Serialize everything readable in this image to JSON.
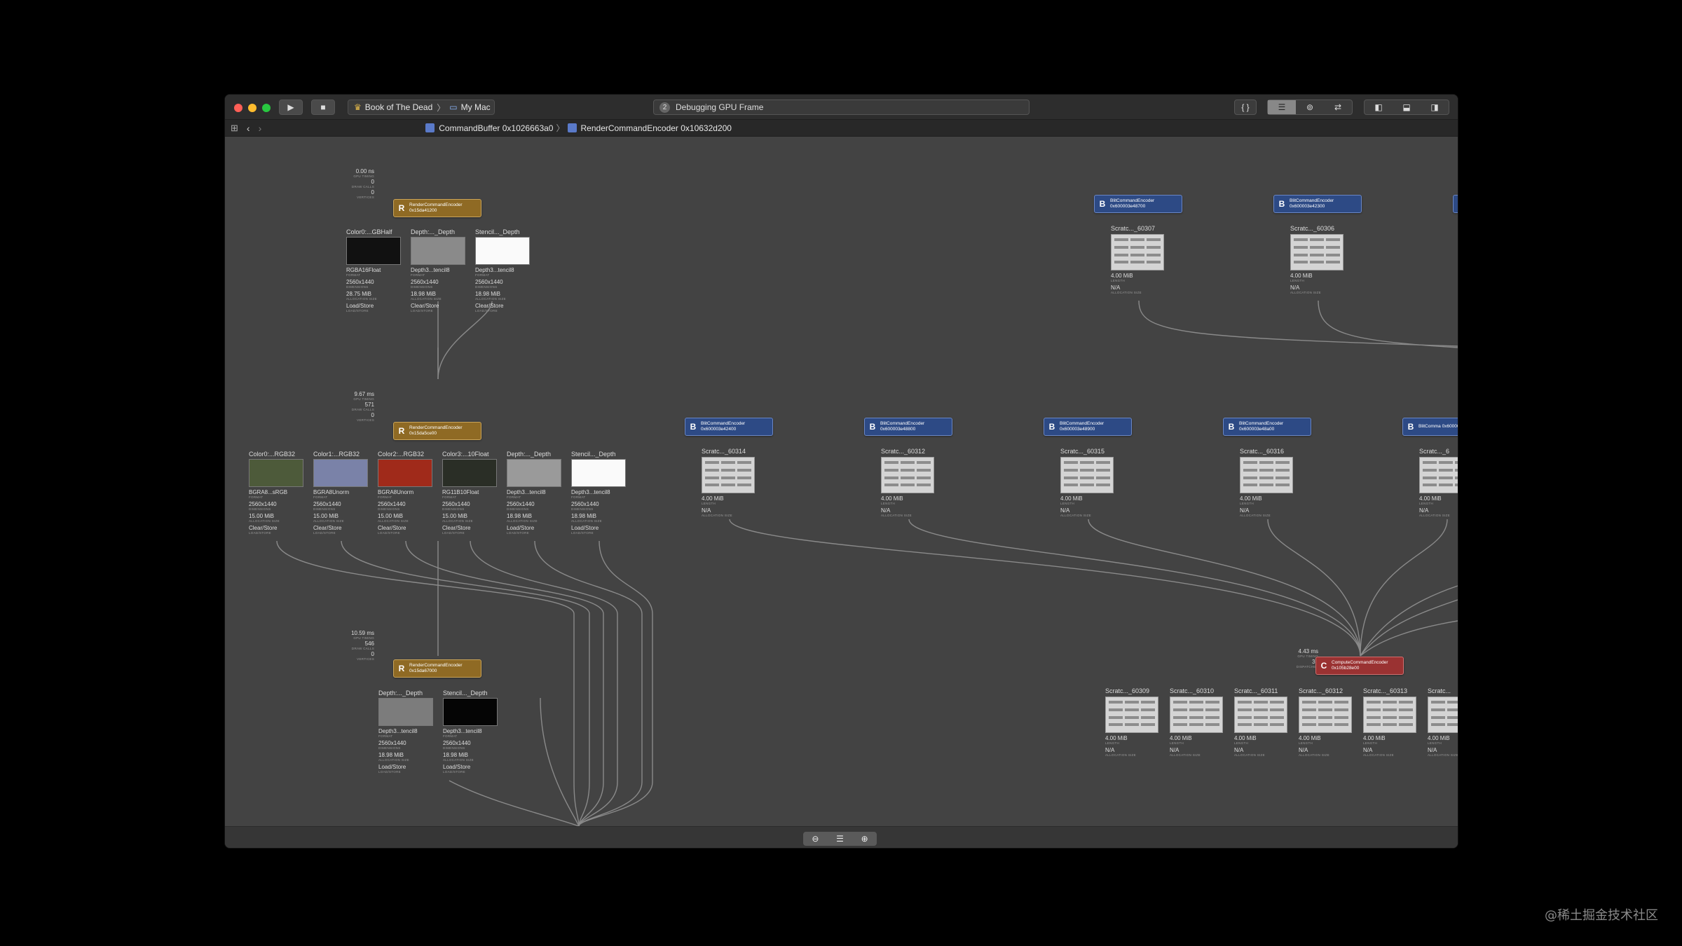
{
  "window": {
    "scheme": "Book of The Dead",
    "destination": "My Mac",
    "activity_number": "2",
    "activity_text": "Debugging GPU Frame"
  },
  "breadcrumb": {
    "item1": "CommandBuffer 0x1026663a0",
    "item2": "RenderCommandEncoder 0x10632d200"
  },
  "labels": {
    "gpu_timing": "GPU TIMING",
    "draw_calls": "DRAW CALLS",
    "vertices": "VERTICES",
    "format": "FORMAT",
    "dimensions": "DIMENSIONS",
    "allocation_size": "ALLOCATION SIZE",
    "load_store": "LOAD/STORE",
    "length": "LENGTH",
    "dispatches": "DISPATCHES"
  },
  "render_encoders": [
    {
      "letter": "R",
      "name": "RenderCommandEncoder 0x15da41200",
      "timing": "0.00 ns",
      "draws": "0",
      "vertices": "0"
    },
    {
      "letter": "R",
      "name": "RenderCommandEncoder 0x15da5ce00",
      "timing": "9.67 ms",
      "draws": "571",
      "vertices": "0"
    },
    {
      "letter": "R",
      "name": "RenderCommandEncoder 0x15da67000",
      "timing": "10.59 ms",
      "draws": "546",
      "vertices": "0"
    }
  ],
  "attachments_1": [
    {
      "title": "Color0:...GBHalf",
      "format": "RGBA16Float",
      "dims": "2560x1440",
      "size": "28.75 MiB",
      "ls": "Load/Store",
      "thumb": "#111"
    },
    {
      "title": "Depth:..._Depth",
      "format": "Depth3...tencil8",
      "dims": "2560x1440",
      "size": "18.98 MiB",
      "ls": "Clear/Store",
      "thumb": "#8a8a8a"
    },
    {
      "title": "Stencil..._Depth",
      "format": "Depth3...tencil8",
      "dims": "2560x1440",
      "size": "18.98 MiB",
      "ls": "Clear/Store",
      "thumb": "#fafafa"
    }
  ],
  "attachments_2": [
    {
      "title": "Color0:...RGB32",
      "format": "BGRA8...sRGB",
      "dims": "2560x1440",
      "size": "15.00 MiB",
      "ls": "Clear/Store",
      "thumb": "#4d5a3a"
    },
    {
      "title": "Color1:...RGB32",
      "format": "BGRA8Unorm",
      "dims": "2560x1440",
      "size": "15.00 MiB",
      "ls": "Clear/Store",
      "thumb": "#7a82a8"
    },
    {
      "title": "Color2:...RGB32",
      "format": "BGRA8Unorm",
      "dims": "2560x1440",
      "size": "15.00 MiB",
      "ls": "Clear/Store",
      "thumb": "#a02a1a"
    },
    {
      "title": "Color3:...10Float",
      "format": "RG11B10Float",
      "dims": "2560x1440",
      "size": "15.00 MiB",
      "ls": "Clear/Store",
      "thumb": "#2a2e26"
    },
    {
      "title": "Depth:..._Depth",
      "format": "Depth3...tencil8",
      "dims": "2560x1440",
      "size": "18.98 MiB",
      "ls": "Load/Store",
      "thumb": "#9a9a9a"
    },
    {
      "title": "Stencil..._Depth",
      "format": "Depth3...tencil8",
      "dims": "2560x1440",
      "size": "18.98 MiB",
      "ls": "Load/Store",
      "thumb": "#fafafa"
    }
  ],
  "attachments_3": [
    {
      "title": "Depth:..._Depth",
      "format": "Depth3...tencil8",
      "dims": "2560x1440",
      "size": "18.98 MiB",
      "ls": "Load/Store",
      "thumb": "#7c7c7c"
    },
    {
      "title": "Stencil..._Depth",
      "format": "Depth3...tencil8",
      "dims": "2560x1440",
      "size": "18.98 MiB",
      "ls": "Load/Store",
      "thumb": "#050505"
    }
  ],
  "blit_top": [
    {
      "letter": "B",
      "name": "BlitCommandEncoder 0x600003e48700",
      "buffer": "Scratc..._60307",
      "length": "4.00 MiB",
      "alloc": "N/A"
    },
    {
      "letter": "B",
      "name": "BlitCommandEncoder 0x600003e42300",
      "buffer": "Scratc..._60306",
      "length": "4.00 MiB",
      "alloc": "N/A"
    }
  ],
  "blit_mid": [
    {
      "letter": "B",
      "name": "BlitCommandEncoder 0x600003e42400",
      "buffer": "Scratc..._60314",
      "length": "4.00 MiB",
      "alloc": "N/A"
    },
    {
      "letter": "B",
      "name": "BlitCommandEncoder 0x600003e48800",
      "buffer": "Scratc..._60312",
      "length": "4.00 MiB",
      "alloc": "N/A"
    },
    {
      "letter": "B",
      "name": "BlitCommandEncoder 0x600003e48900",
      "buffer": "Scratc..._60315",
      "length": "4.00 MiB",
      "alloc": "N/A"
    },
    {
      "letter": "B",
      "name": "BlitCommandEncoder 0x600003e48a00",
      "buffer": "Scratc..._60316",
      "length": "4.00 MiB",
      "alloc": "N/A"
    },
    {
      "letter": "B",
      "name": "BlitComma 0x600003e4",
      "buffer": "Scratc..._6",
      "length": "4.00 MiB",
      "alloc": "N/A"
    }
  ],
  "compute": {
    "letter": "C",
    "name": "ComputeCommandEncoder 0x105b28e00",
    "timing": "4.43 ms",
    "dispatches": "37"
  },
  "compute_buffers": [
    {
      "buffer": "Scratc..._60309",
      "length": "4.00 MiB",
      "alloc": "N/A"
    },
    {
      "buffer": "Scratc..._60310",
      "length": "4.00 MiB",
      "alloc": "N/A"
    },
    {
      "buffer": "Scratc..._60311",
      "length": "4.00 MiB",
      "alloc": "N/A"
    },
    {
      "buffer": "Scratc..._60312",
      "length": "4.00 MiB",
      "alloc": "N/A"
    },
    {
      "buffer": "Scratc..._60313",
      "length": "4.00 MiB",
      "alloc": "N/A"
    },
    {
      "buffer": "Scratc...",
      "length": "4.00 MiB",
      "alloc": "N/A"
    }
  ],
  "watermark": "@稀土掘金技术社区"
}
